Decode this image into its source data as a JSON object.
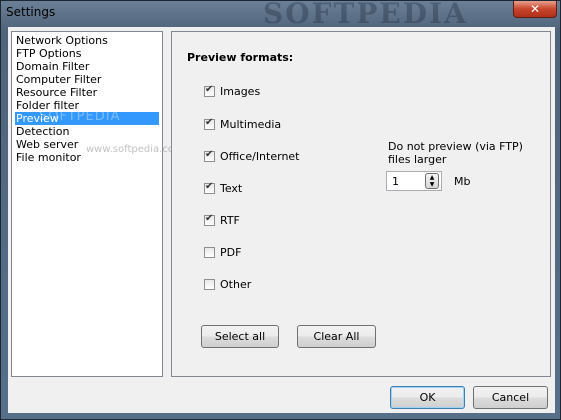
{
  "window": {
    "title": "Settings",
    "watermark": "SOFTPEDIA",
    "close_glyph": "✕"
  },
  "nav": {
    "items": [
      {
        "label": "Network Options"
      },
      {
        "label": "FTP Options"
      },
      {
        "label": "Domain Filter"
      },
      {
        "label": "Computer Filter"
      },
      {
        "label": "Resource Filter"
      },
      {
        "label": "Folder filter"
      },
      {
        "label": "Preview",
        "selected": true
      },
      {
        "label": "Detection"
      },
      {
        "label": "Web server"
      },
      {
        "label": "File monitor"
      }
    ],
    "watermark_small": "www.softpedia.com"
  },
  "preview": {
    "heading": "Preview formats:",
    "formats": [
      {
        "label": "Images",
        "checked": true
      },
      {
        "label": "Multimedia",
        "checked": true
      },
      {
        "label": "Office/Internet",
        "checked": true
      },
      {
        "label": "Text",
        "checked": true
      },
      {
        "label": "RTF",
        "checked": true
      },
      {
        "label": "PDF",
        "checked": false
      },
      {
        "label": "Other",
        "checked": false
      }
    ],
    "select_all_label": "Select all",
    "clear_all_label": "Clear All",
    "no_preview_label": "Do not preview (via FTP) files larger",
    "size_value": "1",
    "size_unit": "Mb"
  },
  "footer": {
    "ok_label": "OK",
    "cancel_label": "Cancel"
  }
}
